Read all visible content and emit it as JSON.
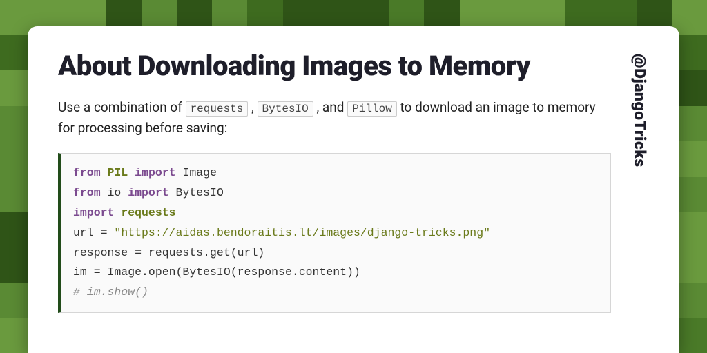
{
  "handle": "@DjangoTricks",
  "title": "About Downloading Images to Memory",
  "desc": {
    "pre": "Use a combination of ",
    "c1": "requests",
    "s1": " , ",
    "c2": "BytesIO",
    "s2": " , and ",
    "c3": "Pillow",
    "post": "  to download an image to memory for processing before saving:"
  },
  "code": {
    "l1_kw1": "from",
    "l1_mod": "PIL",
    "l1_kw2": "import",
    "l1_rest": " Image",
    "l2_kw1": "from",
    "l2_txt": " io ",
    "l2_kw2": "import",
    "l2_rest": " BytesIO",
    "l3_kw": "import",
    "l3_mod": "requests",
    "l4_pre": "url = ",
    "l4_str": "\"https://aidas.bendoraitis.lt/images/django-tricks.png\"",
    "l5": "response = requests.get(url)",
    "l6": "im = Image.open(BytesIO(response.content))",
    "l7": "# im.show()"
  }
}
